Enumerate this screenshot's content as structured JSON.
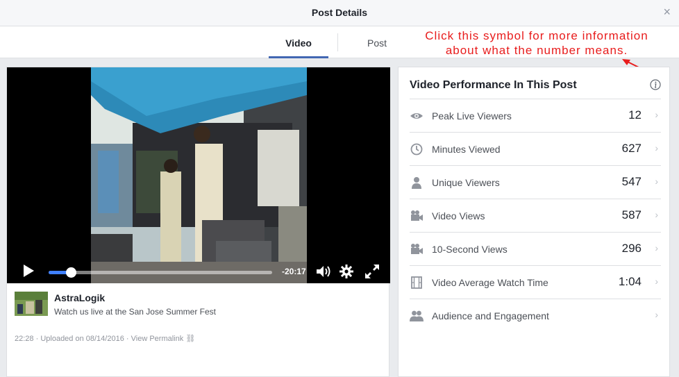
{
  "dialog": {
    "title": "Post Details",
    "close_label": "×"
  },
  "tabs": [
    {
      "label": "Video",
      "active": true
    },
    {
      "label": "Post",
      "active": false
    }
  ],
  "annotation": {
    "text_line1": "Click this symbol for more information",
    "text_line2": "about what the number means.",
    "color": "#e81c1c"
  },
  "video": {
    "progress": 0.1,
    "time_remaining": "-20:17",
    "accent_color": "#4080ff"
  },
  "post": {
    "page_name": "AstraLogik",
    "text": "Watch us live at the San Jose Summer Fest",
    "time": "22:28",
    "uploaded": "Uploaded on 08/14/2016",
    "permalink": "View Permalink"
  },
  "performance": {
    "title": "Video Performance In This Post",
    "metrics": [
      {
        "label": "Peak Live Viewers",
        "value": "12",
        "icon": "eye-icon"
      },
      {
        "label": "Minutes Viewed",
        "value": "627",
        "icon": "clock-icon"
      },
      {
        "label": "Unique Viewers",
        "value": "547",
        "icon": "person-icon"
      },
      {
        "label": "Video Views",
        "value": "587",
        "icon": "video-camera-icon"
      },
      {
        "label": "10-Second Views",
        "value": "296",
        "icon": "video-camera-icon"
      },
      {
        "label": "Video Average Watch Time",
        "value": "1:04",
        "icon": "film-icon"
      },
      {
        "label": "Audience and Engagement",
        "value": "",
        "icon": "people-icon"
      }
    ]
  }
}
